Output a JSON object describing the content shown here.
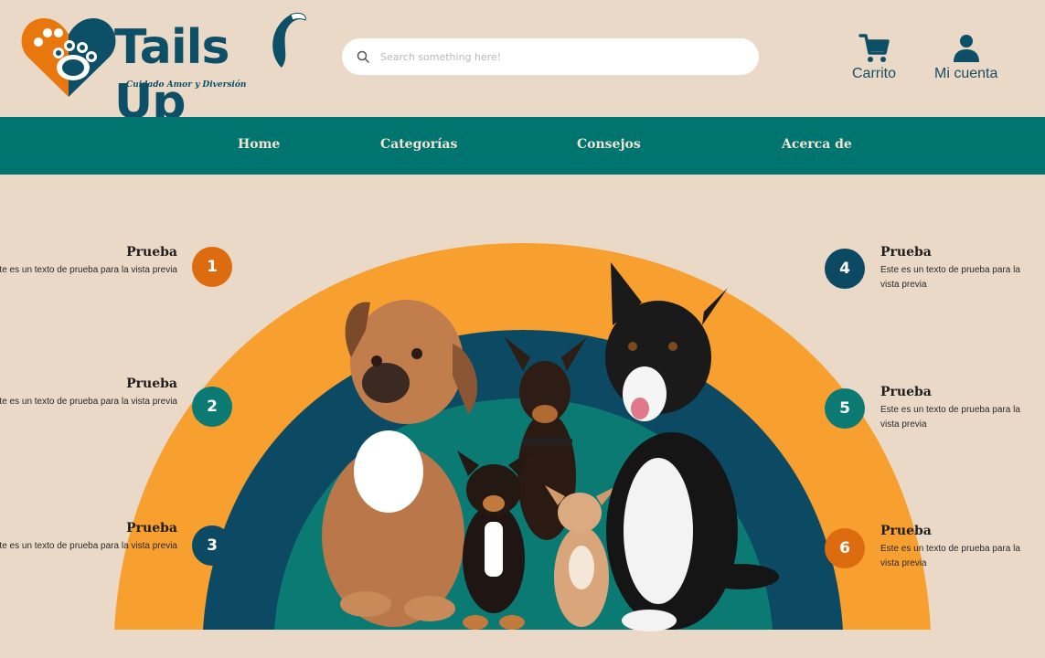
{
  "brand": {
    "name": "Tails Up",
    "tagline": "Cuidado Amor y Diversión"
  },
  "search": {
    "placeholder": "Search something here!"
  },
  "header_actions": {
    "cart_label": "Carrito",
    "account_label": "Mi cuenta"
  },
  "nav": {
    "items": [
      {
        "label": "Home"
      },
      {
        "label": "Categorías"
      },
      {
        "label": "Consejos"
      },
      {
        "label": "Acerca de"
      }
    ]
  },
  "features": [
    {
      "number": "1",
      "title": "Prueba",
      "text": "Este es un texto de prueba para la vista previa",
      "color": "#dd6b10"
    },
    {
      "number": "2",
      "title": "Prueba",
      "text": "Este es un texto de prueba para la vista previa",
      "color": "#0a7a73"
    },
    {
      "number": "3",
      "title": "Prueba",
      "text": "Este es un texto de prueba para la vista previa",
      "color": "#0c4a63"
    },
    {
      "number": "4",
      "title": "Prueba",
      "text": "Este es un texto de prueba para la vista previa",
      "color": "#0c4a63"
    },
    {
      "number": "5",
      "title": "Prueba",
      "text": "Este es un texto de prueba para la vista previa",
      "color": "#0a7a73"
    },
    {
      "number": "6",
      "title": "Prueba",
      "text": "Este es un texto de prueba para la vista previa",
      "color": "#dd6b10"
    }
  ],
  "colors": {
    "background": "#ead9c6",
    "nav": "#007570",
    "arc_outer": "#f7a030",
    "arc_middle": "#0c4a63",
    "arc_inner": "#0a7a73",
    "brand_blue": "#0d4f66",
    "brand_orange": "#e8780e"
  },
  "icons": {
    "search": "search-icon",
    "cart": "cart-icon",
    "account": "user-icon",
    "logo": "heart-paw-icon"
  }
}
